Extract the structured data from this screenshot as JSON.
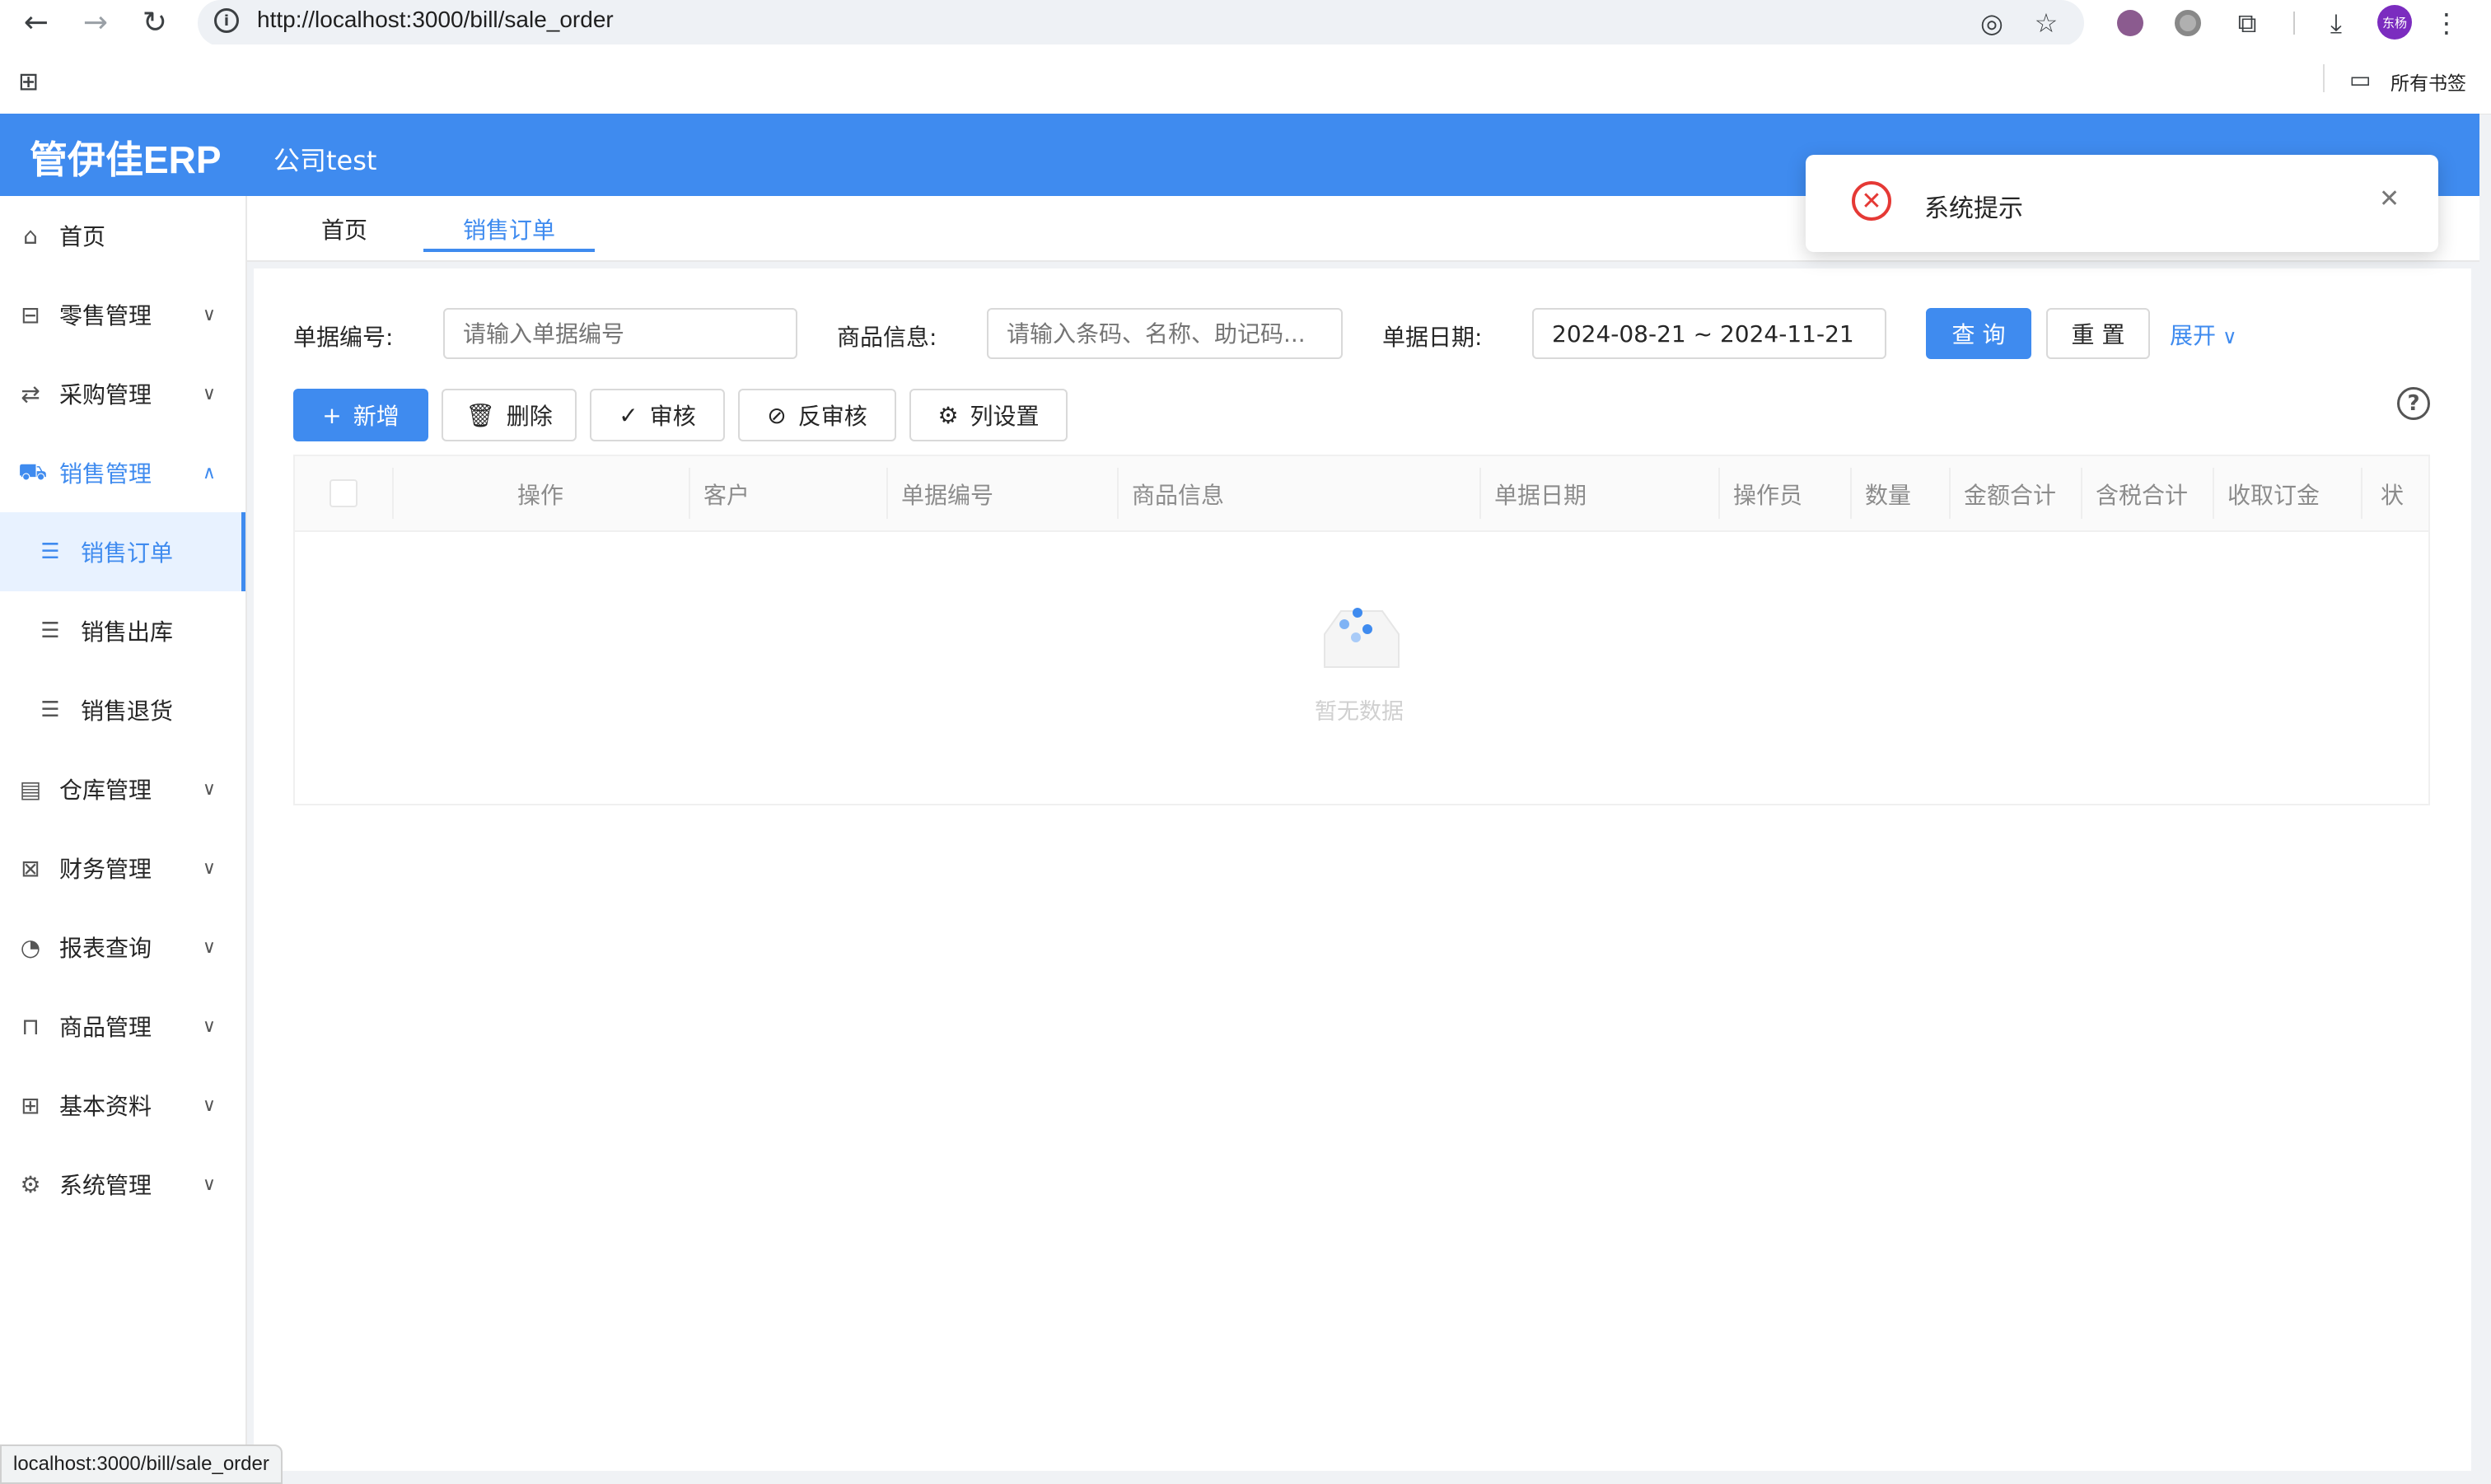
{
  "browser": {
    "url": "http://localhost:3000/bill/sale_order",
    "bookmarks_label": "所有书签",
    "profile_label": "东杨",
    "status_url": "localhost:3000/bill/sale_order"
  },
  "header": {
    "logo": "管伊佳ERP",
    "company": "公司test",
    "bg_color": "#3f8bef"
  },
  "sidebar": {
    "items": [
      {
        "label": "首页",
        "icon": "home-icon"
      },
      {
        "label": "零售管理",
        "icon": "gift-icon"
      },
      {
        "label": "采购管理",
        "icon": "swap-icon"
      },
      {
        "label": "销售管理",
        "icon": "cart-icon"
      },
      {
        "label": "销售订单",
        "icon": "file-icon"
      },
      {
        "label": "销售出库",
        "icon": "file-icon"
      },
      {
        "label": "销售退货",
        "icon": "file-icon"
      },
      {
        "label": "仓库管理",
        "icon": "warehouse-icon"
      },
      {
        "label": "财务管理",
        "icon": "account-book-icon"
      },
      {
        "label": "报表查询",
        "icon": "pie-chart-icon"
      },
      {
        "label": "商品管理",
        "icon": "shopping-icon"
      },
      {
        "label": "基本资料",
        "icon": "appstore-icon"
      },
      {
        "label": "系统管理",
        "icon": "setting-icon"
      }
    ]
  },
  "tabs": [
    {
      "label": "首页"
    },
    {
      "label": "销售订单"
    }
  ],
  "filters": {
    "bill_no_label": "单据编号:",
    "bill_no_placeholder": "请输入单据编号",
    "goods_label": "商品信息:",
    "goods_placeholder": "请输入条码、名称、助记码...",
    "date_label": "单据日期:",
    "date_value": "2024-08-21 ~ 2024-11-21",
    "query_btn": "查 询",
    "reset_btn": "重 置",
    "expand_link": "展开"
  },
  "toolbar": {
    "add": "新增",
    "delete": "删除",
    "audit": "审核",
    "unaudit": "反审核",
    "columns": "列设置"
  },
  "table": {
    "columns": [
      "操作",
      "客户",
      "单据编号",
      "商品信息",
      "单据日期",
      "操作员",
      "数量",
      "金额合计",
      "含税合计",
      "收取订金",
      "状"
    ],
    "empty_text": "暂无数据"
  },
  "notification": {
    "title": "系统提示"
  }
}
